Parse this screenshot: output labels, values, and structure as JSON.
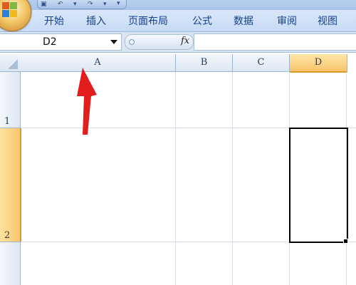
{
  "ribbon": {
    "quick_access": {
      "save_icon": "save-icon",
      "undo_icon": "undo-icon",
      "redo_icon": "redo-icon",
      "more_icon": "chevron-down-icon"
    },
    "tabs": [
      {
        "label": "开始"
      },
      {
        "label": "插入"
      },
      {
        "label": "页面布局"
      },
      {
        "label": "公式"
      },
      {
        "label": "数据"
      },
      {
        "label": "审阅"
      },
      {
        "label": "视图"
      }
    ]
  },
  "formula_bar": {
    "name_box": "D2",
    "fx_label": "fx",
    "formula": ""
  },
  "sheet": {
    "columns": [
      "A",
      "B",
      "C",
      "D"
    ],
    "rows": [
      "1",
      "2"
    ],
    "selected_cell": "D2",
    "selected_column": "D",
    "selected_row": "2"
  },
  "annotation": {
    "arrow_color": "#e11d1d",
    "points_to": "A"
  },
  "colors": {
    "tab_text": "#15428b",
    "selection_header": "#f7c46c",
    "grid_line": "#d8dfe8"
  }
}
